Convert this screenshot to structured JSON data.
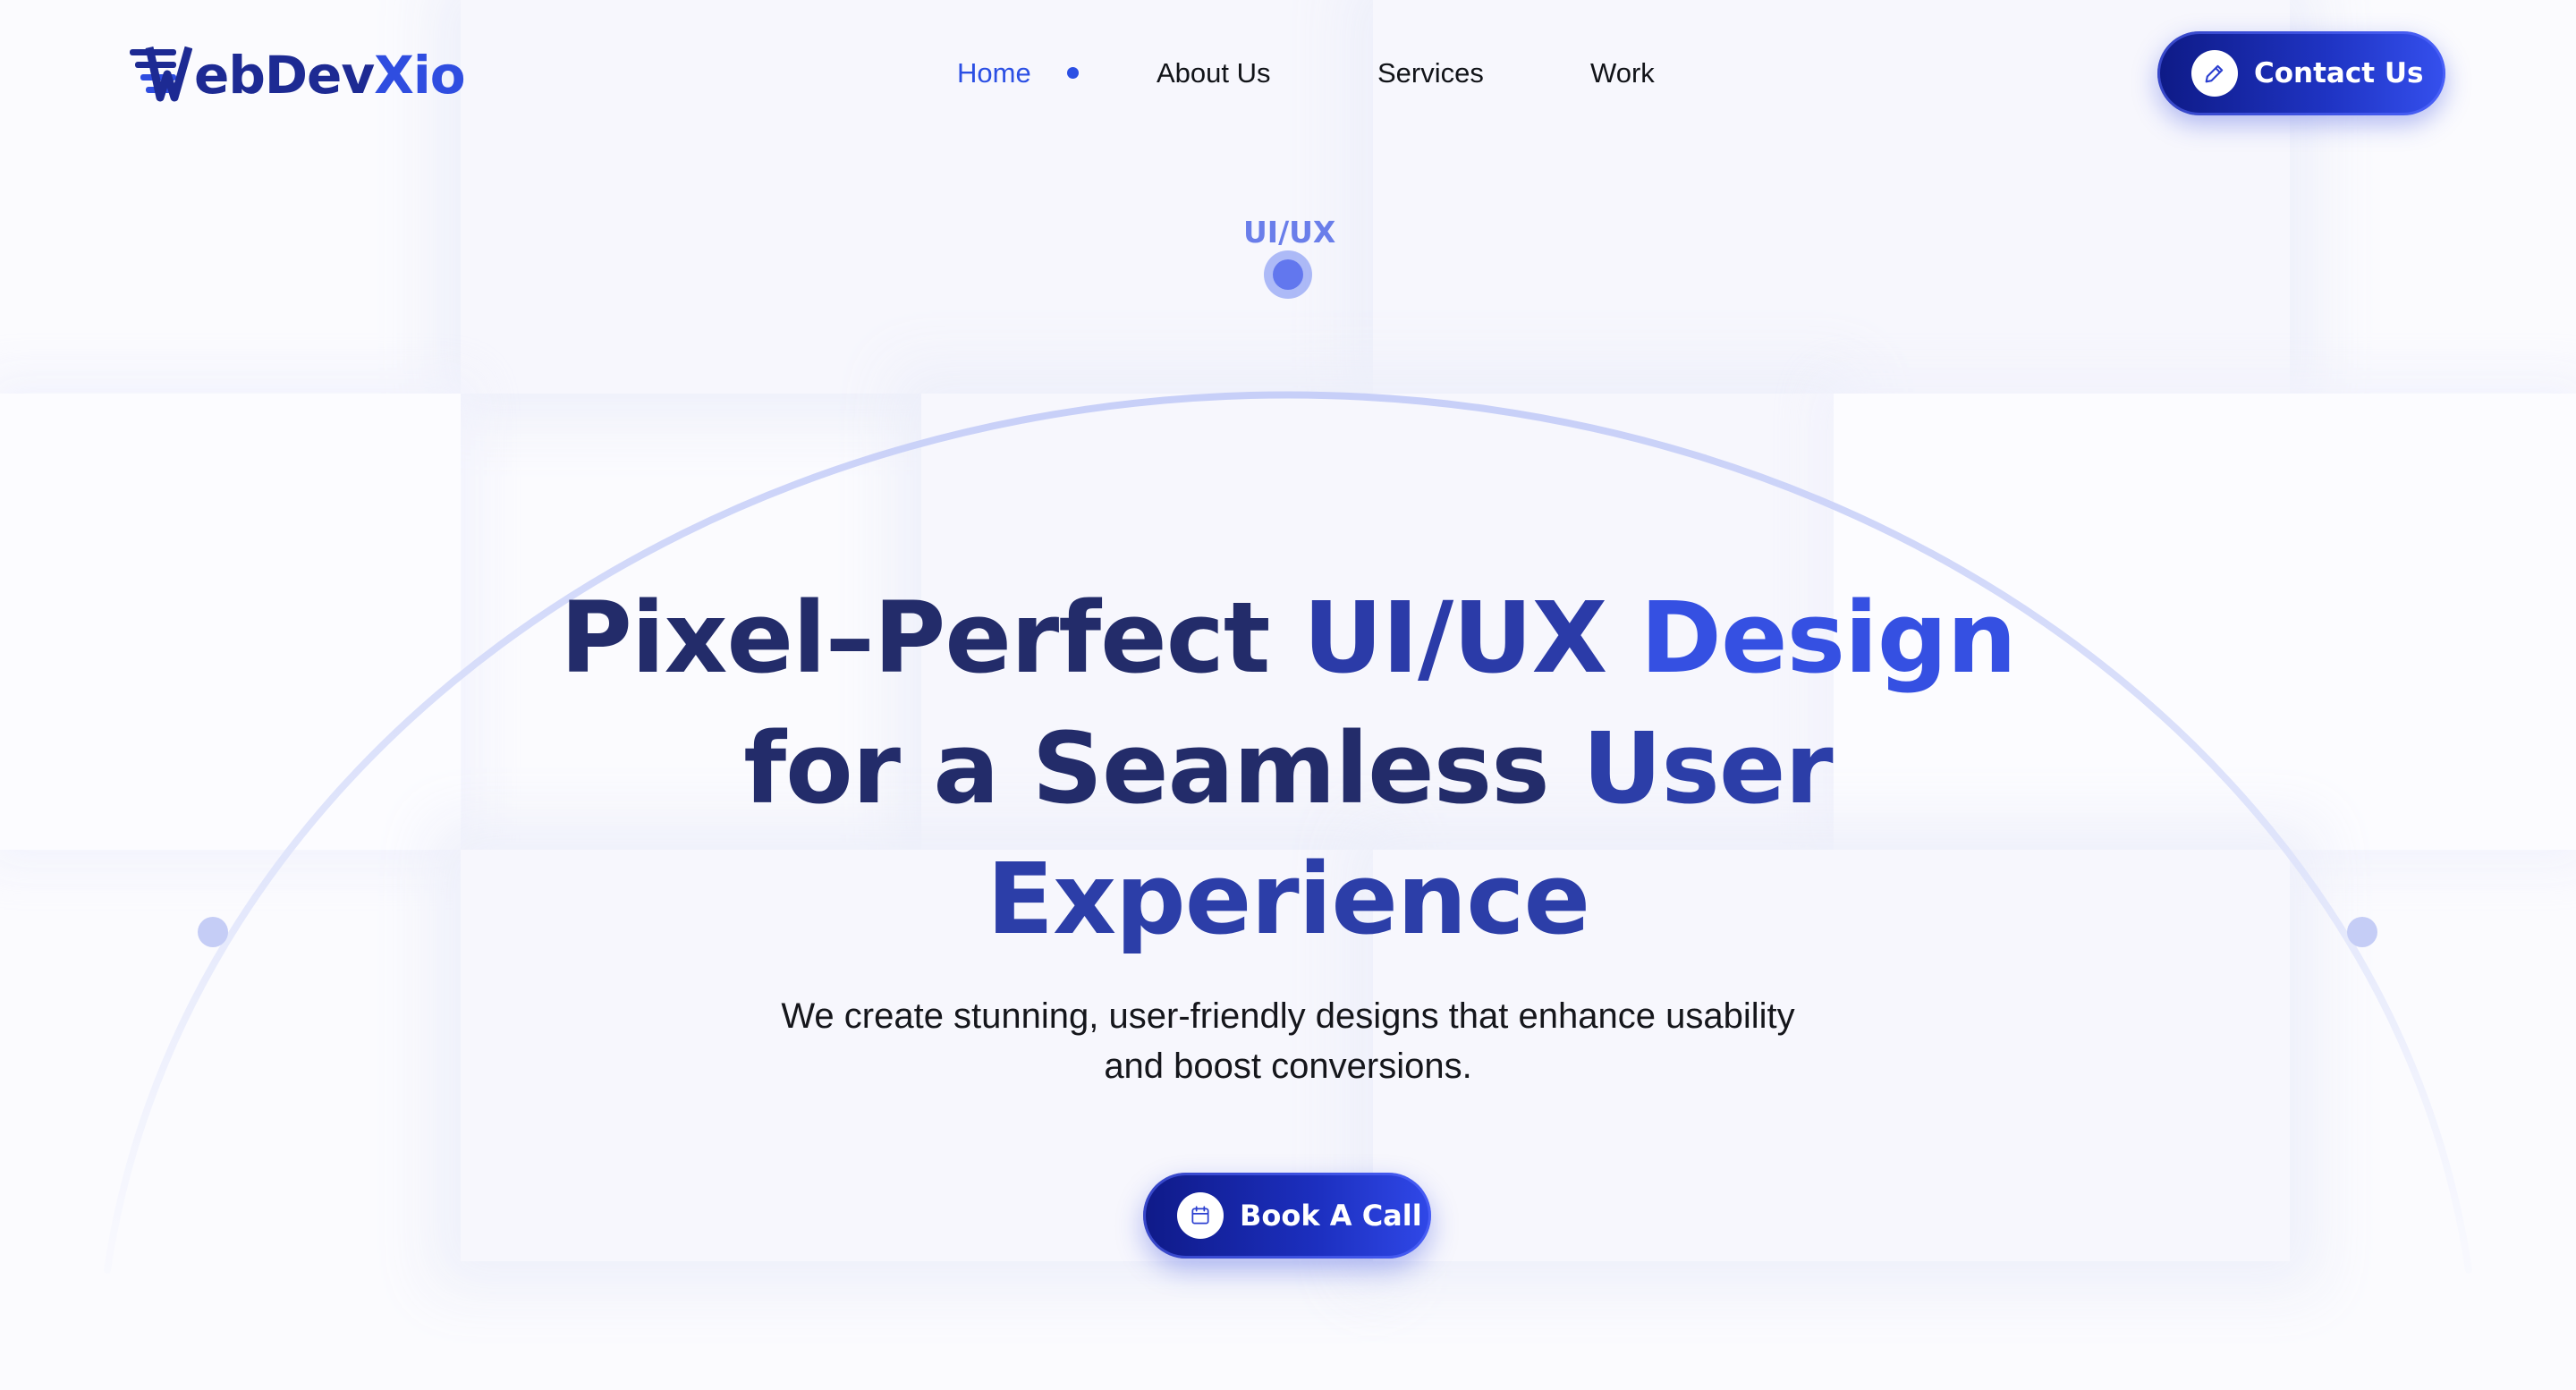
{
  "brand": {
    "logo_text_main": "ebDev",
    "logo_text_accent": "Xio",
    "logo_full": "WebDevXio",
    "logo_icon": "w-stripes-logo"
  },
  "nav": {
    "items": [
      {
        "label": "Home",
        "active": true
      },
      {
        "label": "About Us",
        "active": false
      },
      {
        "label": "Services",
        "active": false
      },
      {
        "label": "Work",
        "active": false
      }
    ]
  },
  "header": {
    "contact_label": "Contact Us",
    "contact_icon": "pencil-icon"
  },
  "hero": {
    "marker_label": "UI/UX",
    "title_line1_a": "Pixel–Perfect ",
    "title_line1_b": "UI/UX ",
    "title_line1_c": "Design",
    "title_line2_a": "for a Seamless ",
    "title_line2_b": "User",
    "title_line3": "Experience",
    "subtitle_line1": "We create stunning, user-friendly designs that enhance usability",
    "subtitle_line2": "and boost conversions.",
    "cta_label": "Book A Call",
    "cta_icon": "calendar-icon"
  },
  "colors": {
    "primary": "#2b4fe4",
    "navy": "#1d2a93",
    "heading": "#232c6a",
    "accent_blue": "#3550e2",
    "background": "#fbfbfe"
  }
}
